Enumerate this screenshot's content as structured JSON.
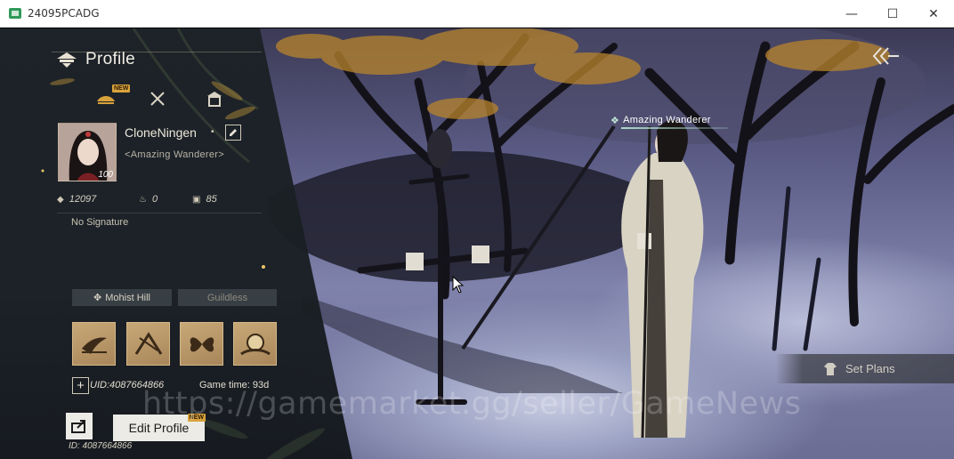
{
  "window": {
    "title": "24095PCADG",
    "minimize": "—",
    "maximize": "☐",
    "close": "✕"
  },
  "profile": {
    "heading": "Profile",
    "tabs": [
      {
        "icon": "sun-crest-icon",
        "new_badge": "NEW"
      },
      {
        "icon": "crossed-swords-icon"
      },
      {
        "icon": "pavilion-icon"
      }
    ],
    "player_name": "CloneNingen",
    "gender_symbol": "•",
    "title": "<Amazing Wanderer>",
    "level": "100",
    "stats": [
      {
        "icon": "diamond-icon",
        "value": "12097"
      },
      {
        "icon": "flame-icon",
        "value": "0"
      },
      {
        "icon": "chart-icon",
        "value": "85"
      }
    ],
    "signature": "No Signature",
    "sect": "Mohist Hill",
    "guild": "Guildless",
    "badges": [
      "crane-badge-icon",
      "wind-badge-icon",
      "butterfly-badge-icon",
      "moon-badge-icon"
    ],
    "plus_label": "+",
    "uid_label": "UID:4087664866",
    "game_time": "Game time: 93d",
    "edit_profile": "Edit Profile",
    "edit_new_badge": "NEW",
    "bottom_id": "ID: 4087664866"
  },
  "scene": {
    "nameplate": "Amazing Wanderer",
    "set_plans": "Set Plans",
    "watermark": "https://gamemarket.gg/seller/GameNews"
  },
  "colors": {
    "panel": "#1c2226",
    "accent_gold": "#d9a23b",
    "badge_bg": "#c8a877",
    "button_bg": "#ecebe6"
  }
}
